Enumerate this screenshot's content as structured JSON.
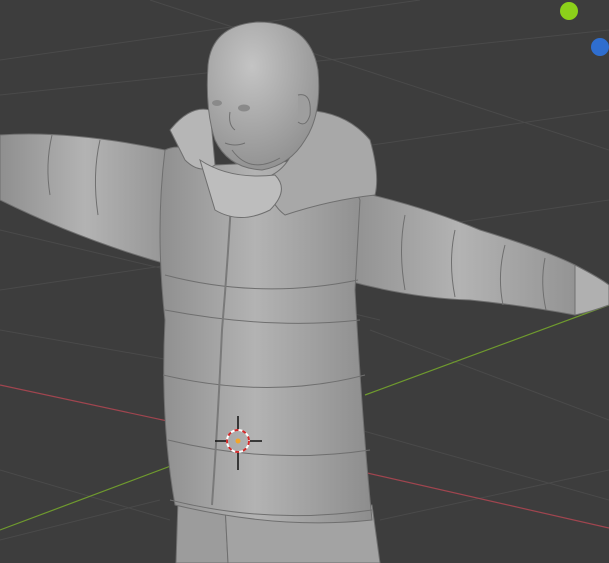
{
  "app": {
    "view": "3D Viewport"
  },
  "viewport": {
    "background": "#3d3d3d",
    "grid_color": "#4a4a4a",
    "x_axis_color": "#a0454f",
    "y_axis_color": "#6f9a2e"
  },
  "model": {
    "material_color": "#a9a9a9",
    "edge_color": "#6f6f6f"
  },
  "cursor": {
    "ring_color_a": "#d22a2a",
    "ring_color_b": "#ffffff",
    "center_color": "#f3a52a"
  },
  "gizmo": {
    "y_color": "#8cd11a",
    "z_color": "#2f6ecf"
  }
}
